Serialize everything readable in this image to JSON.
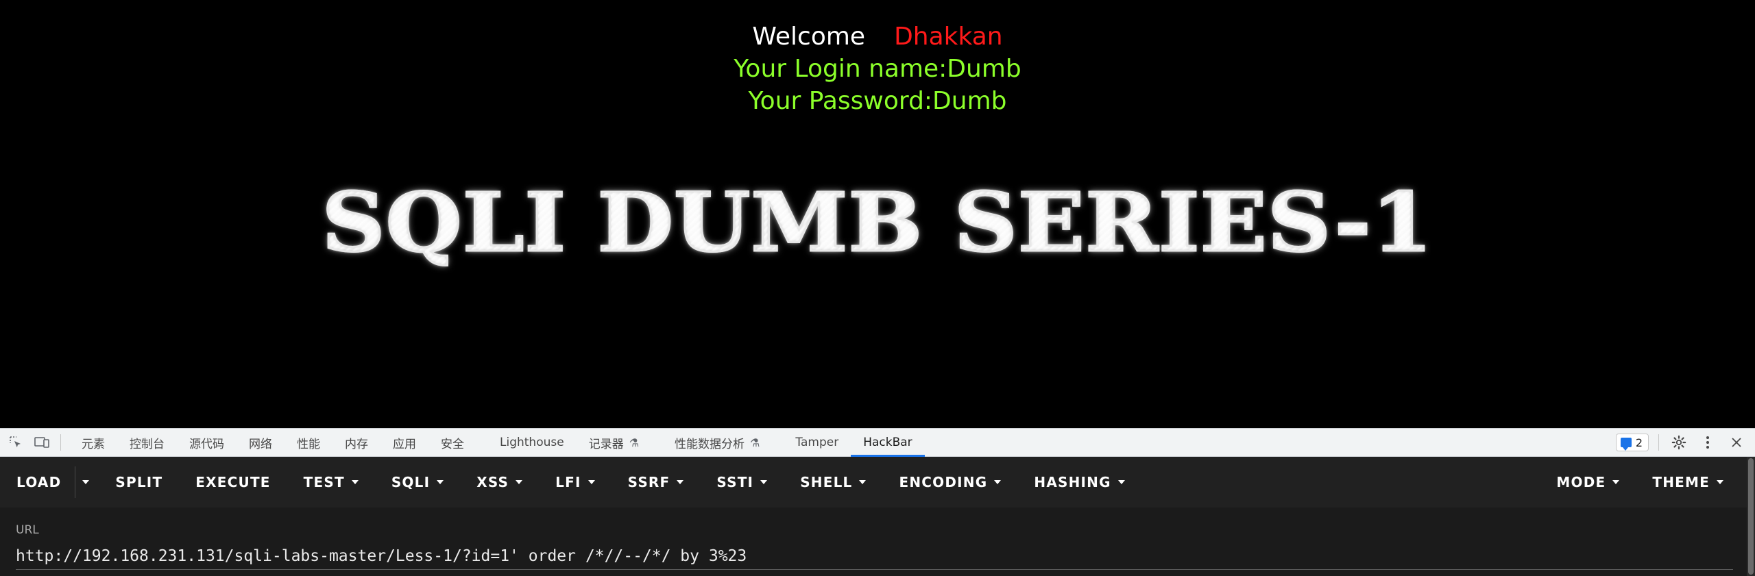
{
  "page": {
    "welcome_word": "Welcome",
    "welcome_user": "Dhakkan",
    "login_line": "Your Login name:Dumb",
    "password_line": "Your Password:Dumb",
    "banner_title": "SQLI DUMB SERIES-1",
    "colors": {
      "welcome": "#ffffff",
      "user": "#ff1a1a",
      "info": "#8cff2a"
    }
  },
  "devtools": {
    "tabs": [
      "元素",
      "控制台",
      "源代码",
      "网络",
      "性能",
      "内存",
      "应用",
      "安全",
      "Lighthouse",
      "记录器",
      "性能数据分析",
      "Tamper",
      "HackBar"
    ],
    "active_tab": "HackBar",
    "issues_count": "2",
    "icons": [
      "inspect-element-icon",
      "device-toolbar-icon",
      "flask-icon",
      "settings-gear-icon",
      "more-vertical-icon",
      "close-icon"
    ]
  },
  "hackbar": {
    "buttons": {
      "load": "LOAD",
      "split": "SPLIT",
      "execute": "EXECUTE",
      "test": "TEST",
      "sqli": "SQLI",
      "xss": "XSS",
      "lfi": "LFI",
      "ssrf": "SSRF",
      "ssti": "SSTI",
      "shell": "SHELL",
      "encoding": "ENCODING",
      "hashing": "HASHING",
      "mode": "MODE",
      "theme": "THEME"
    },
    "url_label": "URL",
    "url_value": "http://192.168.231.131/sqli-labs-master/Less-1/?id=1' order /*//--/*/ by 3%23"
  }
}
